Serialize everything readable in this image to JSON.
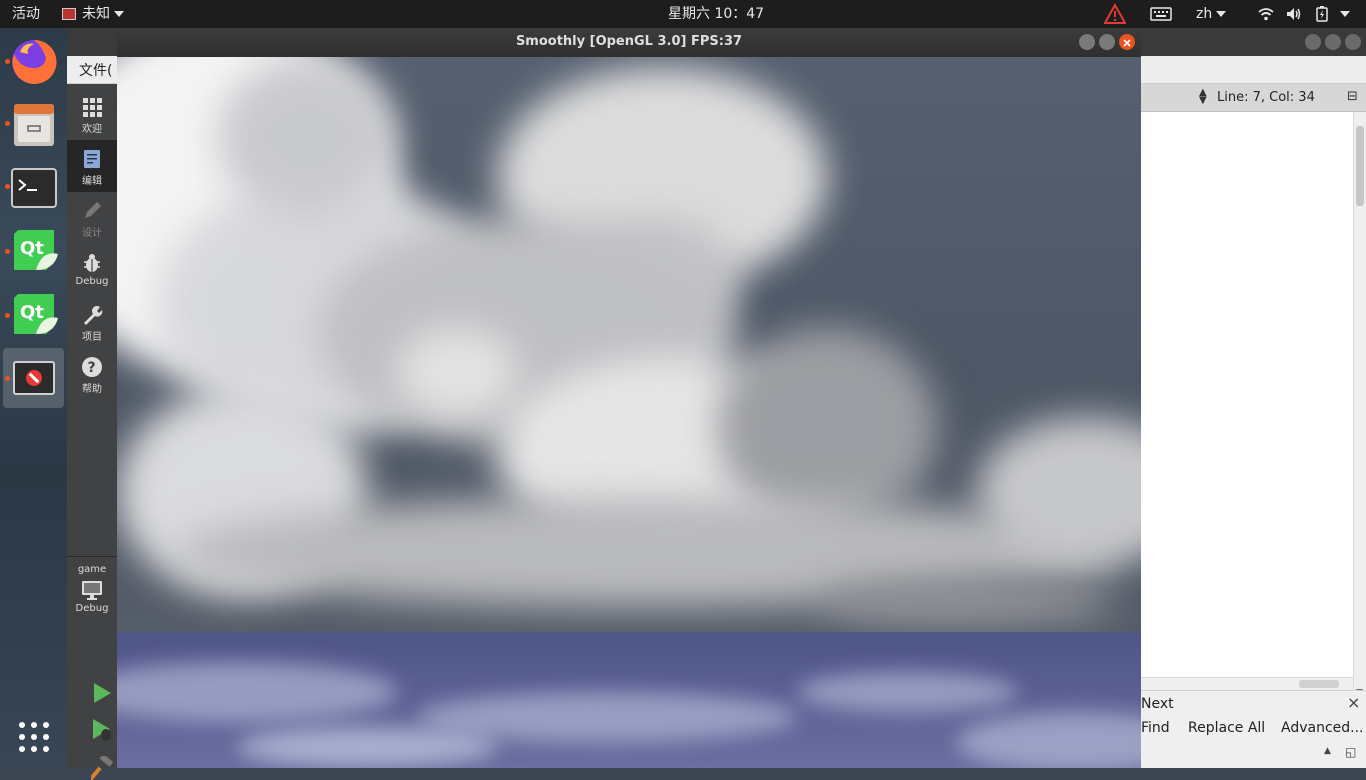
{
  "topbar": {
    "activities": "活动",
    "app_menu": "未知",
    "clock": "星期六 10：47",
    "input_method": "zh"
  },
  "dock": {
    "items": [
      "firefox-icon",
      "files-icon",
      "terminal-icon",
      "qt-creator-icon",
      "qt-designer-icon",
      "unknown-app-icon",
      "show-applications-icon"
    ]
  },
  "qtcreator": {
    "menu_file": "文件(",
    "modes": [
      {
        "label": "欢迎"
      },
      {
        "label": "编辑"
      },
      {
        "label": "设计"
      },
      {
        "label": "Debug"
      },
      {
        "label": "项目"
      },
      {
        "label": "帮助"
      }
    ],
    "kit_project": "game",
    "kit_mode": "Debug",
    "cursor_position": "Line: 7, Col: 34",
    "find": {
      "next": "Next",
      "find": "Find",
      "replace_all": "Replace All",
      "advanced": "Advanced..."
    }
  },
  "smoothly": {
    "title": "Smoothly [OpenGL 3.0] FPS:37"
  },
  "colors": {
    "topbar_bg": "#1d1d1d",
    "accent": "#e95420",
    "qt_green": "#41cd52"
  }
}
